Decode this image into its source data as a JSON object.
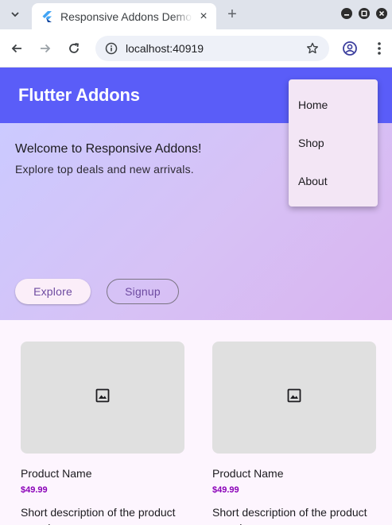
{
  "browser": {
    "tab_title": "Responsive Addons Demo",
    "tab_close": "×",
    "new_tab": "+",
    "url": "localhost:40919"
  },
  "app": {
    "title": "Flutter Addons"
  },
  "menu": {
    "items": [
      "Home",
      "Shop",
      "About"
    ]
  },
  "hero": {
    "heading": "Welcome to Responsive Addons!",
    "subheading": "Explore top deals and new arrivals.",
    "explore_label": "Explore",
    "signup_label": "Signup"
  },
  "products": [
    {
      "name": "Product Name",
      "price": "$49.99",
      "description": "Short description of the product goes here."
    },
    {
      "name": "Product Name",
      "price": "$49.99",
      "description": "Short description of the product goes here."
    }
  ],
  "colors": {
    "appbar": "#5a5df8",
    "menu_bg": "#f3e6f5",
    "price": "#8a00b8",
    "button_text": "#6d4aa0"
  },
  "icons": {
    "tab_search": "chevron-down-icon",
    "favicon": "flutter-icon",
    "back": "arrow-left-icon",
    "forward": "arrow-right-icon",
    "reload": "reload-icon",
    "site_info": "info-icon",
    "bookmark": "star-icon",
    "profile": "account-icon",
    "menu": "more-vert-icon",
    "product_image": "image-placeholder-icon"
  }
}
